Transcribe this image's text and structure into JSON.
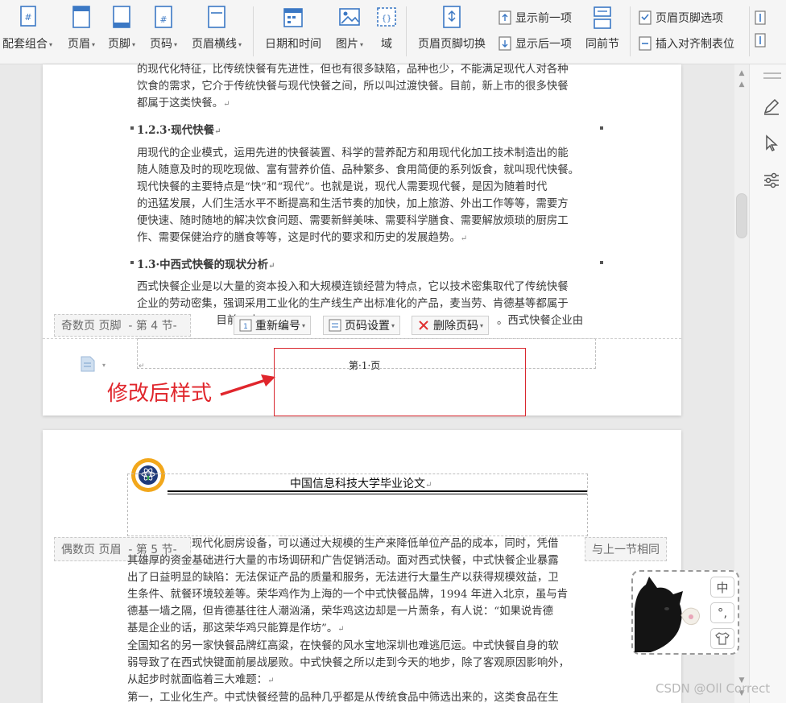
{
  "toolbar": {
    "combo": "配套组合",
    "header": "页眉",
    "footer": "页脚",
    "page_number": "页码",
    "header_line": "页眉横线",
    "date_time": "日期和时间",
    "picture": "图片",
    "field": "域",
    "switch_hf": "页眉页脚切换",
    "show_prev": "显示前一项",
    "show_next": "显示后一项",
    "same_as_prev": "同前节",
    "hf_options": "页眉页脚选项",
    "insert_align_tab": "插入对齐制表位"
  },
  "page1": {
    "para_top": [
      "的现代化特征，比传统快餐有先进性，但也有很多缺陷，品种也少，不能满足现代人对各种",
      "饮食的需求，它介于传统快餐与现代快餐之间，所以叫过渡快餐。目前，新上市的很多快餐",
      "都属于这类快餐。"
    ],
    "heading_1": "1.2.3·现代快餐",
    "para_mid": [
      "用现代的企业模式，运用先进的快餐装置、科学的营养配方和用现代化加工技术制造出的能",
      "随人随意及时的现吃现做、富有营养价值、品种繁多、食用简便的系列饭食，就叫现代快餐。",
      "现代快餐的主要特点是“快”和“现代”。也就是说，现代人需要现代餐，是因为随着时代",
      "的迅猛发展，人们生活水平不断提高和生活节奏的加快，加上旅游、外出工作等等，需要方",
      "便快速、随时随地的解决饮食问题、需要新鲜美味、需要科学膳食、需要解放烦琐的厨房工",
      "作、需要保健治疗的膳食等等，这是时代的要求和历史的发展趋势。"
    ],
    "heading_2": "1.3·中西式快餐的现状分析",
    "para_bottom": [
      "西式快餐企业是以大量的资本投入和大规模连锁经营为特点，它以技术密集取代了传统快餐",
      "企业的劳动密集，强调采用工业化的生产线生产出标准化的产品，麦当劳、肯德基等都属于",
      "中                    目前，中"
    ],
    "para_bottom_tail": "。西式快餐企业由",
    "footer_label": "奇数页 页脚",
    "footer_section": "- 第 4 节-",
    "renumber_btn": "重新编号",
    "page_num_settings_btn": "页码设置",
    "delete_page_num_btn": "删除页码",
    "page_number_text": "第·1·页"
  },
  "annotation": "修改后样式",
  "page2": {
    "header_title": "中国信息科技大学毕业论文",
    "header_label": "偶数页 页眉",
    "header_section": "- 第 5 节-",
    "same_as_prev_label": "与上一节相同",
    "para": [
      "现代化厨房设备，可以通过大规模的生产来降低单位产品的成本，同时，凭借",
      "其雄厚的资金基础进行大量的市场调研和广告促销活动。面对西式快餐，中式快餐企业暴露",
      "出了日益明显的缺陷：无法保证产品的质量和服务，无法进行大量生产以获得规模效益，卫",
      "生条件、就餐环境较差等。荣华鸡作为上海的一个中式快餐品牌，1994 年进入北京，虽与肯",
      "德基一墙之隔，但肯德基往往人潮汹涌，荣华鸡这边却是一片萧条，有人说：“如果说肯德",
      "基是企业的话，那这荣华鸡只能算是作坊”。",
      "全国知名的另一家快餐品牌红高粱，在快餐的风水宝地深圳也难逃厄运。中式快餐自身的软",
      "弱导致了在西式快键面前屡战屡败。中式快餐之所以走到今天的地步，除了客观原因影响外，",
      "从起步时就面临着三大难题：",
      "第一，工业化生产。中式快餐经营的品种几乎都是从传统食品中筛选出来的，这类食品在生"
    ]
  },
  "ime": {
    "lang": "中",
    "punct": "°,",
    "skin_icon": "shirt-icon"
  },
  "watermark": "CSDN @Oll Correct",
  "colors": {
    "annotation_red": "#e0262c",
    "icon_blue": "#3b78c4"
  }
}
